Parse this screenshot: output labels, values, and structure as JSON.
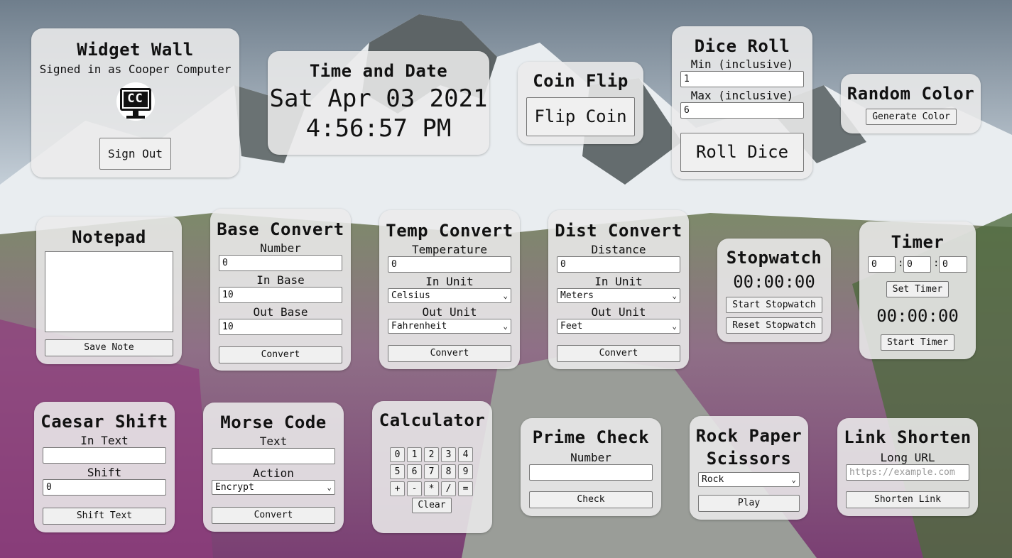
{
  "widget_wall": {
    "title": "Widget Wall",
    "signed_in": "Signed in as Cooper Computer",
    "logo_text": "CC",
    "sign_out": "Sign Out"
  },
  "time_date": {
    "title": "Time and Date",
    "date": "Sat Apr 03 2021",
    "time": "4:56:57 PM"
  },
  "coin_flip": {
    "title": "Coin Flip",
    "button": "Flip Coin"
  },
  "dice_roll": {
    "title": "Dice Roll",
    "min_label": "Min (inclusive)",
    "min_value": "1",
    "max_label": "Max (inclusive)",
    "max_value": "6",
    "button": "Roll Dice"
  },
  "random_color": {
    "title": "Random Color",
    "button": "Generate Color"
  },
  "notepad": {
    "title": "Notepad",
    "text": "",
    "button": "Save Note"
  },
  "base_convert": {
    "title": "Base Convert",
    "number_label": "Number",
    "number_value": "0",
    "in_label": "In Base",
    "in_value": "10",
    "out_label": "Out Base",
    "out_value": "10",
    "button": "Convert"
  },
  "temp_convert": {
    "title": "Temp Convert",
    "temp_label": "Temperature",
    "temp_value": "0",
    "in_label": "In Unit",
    "in_value": "Celsius",
    "out_label": "Out Unit",
    "out_value": "Fahrenheit",
    "button": "Convert"
  },
  "dist_convert": {
    "title": "Dist Convert",
    "dist_label": "Distance",
    "dist_value": "0",
    "in_label": "In Unit",
    "in_value": "Meters",
    "out_label": "Out Unit",
    "out_value": "Feet",
    "button": "Convert"
  },
  "stopwatch": {
    "title": "Stopwatch",
    "display": "00:00:00",
    "start": "Start Stopwatch",
    "reset": "Reset Stopwatch"
  },
  "timer": {
    "title": "Timer",
    "h": "0",
    "m": "0",
    "s": "0",
    "sep": ":",
    "set": "Set Timer",
    "display": "00:00:00",
    "start": "Start Timer"
  },
  "caesar": {
    "title": "Caesar Shift",
    "in_label": "In Text",
    "in_value": "",
    "shift_label": "Shift",
    "shift_value": "0",
    "button": "Shift Text"
  },
  "morse": {
    "title": "Morse Code",
    "text_label": "Text",
    "text_value": "",
    "action_label": "Action",
    "action_value": "Encrypt",
    "button": "Convert"
  },
  "calculator": {
    "title": "Calculator",
    "keys": [
      "0",
      "1",
      "2",
      "3",
      "4",
      "5",
      "6",
      "7",
      "8",
      "9",
      "+",
      "-",
      "*",
      "/",
      "="
    ],
    "clear": "Clear"
  },
  "prime": {
    "title": "Prime Check",
    "number_label": "Number",
    "number_value": "",
    "button": "Check"
  },
  "rps": {
    "title_line1": "Rock Paper",
    "title_line2": "Scissors",
    "choice": "Rock",
    "button": "Play"
  },
  "link": {
    "title": "Link Shorten",
    "label": "Long URL",
    "placeholder": "https://example.com",
    "button": "Shorten Link"
  },
  "colors": {
    "panel": "#ebebeb",
    "button": "#f0f0f0",
    "border": "#777777"
  }
}
